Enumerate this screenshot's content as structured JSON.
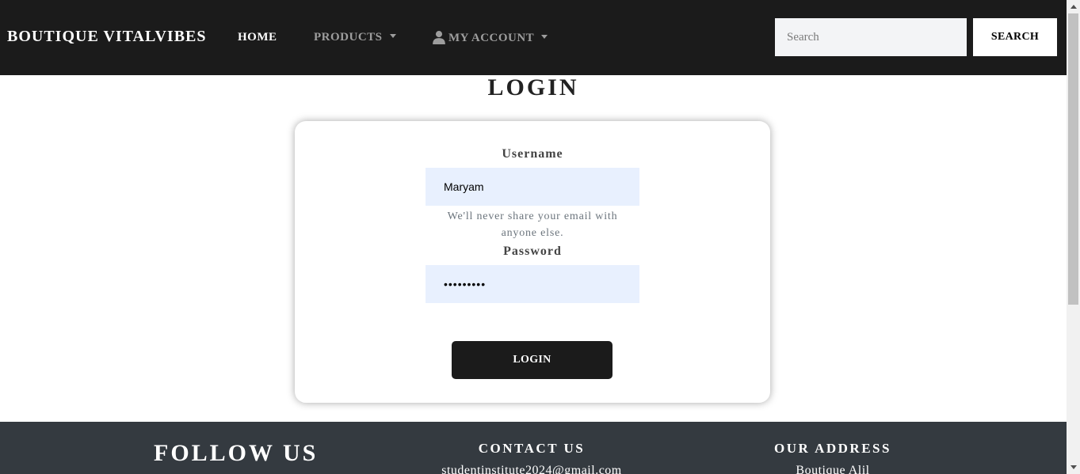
{
  "navbar": {
    "brand": "BOUTIQUE VITALVIBES",
    "home": "HOME",
    "products": "PRODUCTS",
    "account": "MY ACCOUNT",
    "search_placeholder": "Search",
    "search_button": "SEARCH",
    "account_icon": "user-icon"
  },
  "login": {
    "title": "LOGIN",
    "username_label": "Username",
    "username_value": "Maryam",
    "help_text": "We'll never share your email with anyone else.",
    "password_label": "Password",
    "password_value": "password1",
    "button": "LOGIN"
  },
  "footer": {
    "follow": "FOLLOW US",
    "contact_heading": "CONTACT US",
    "contact_email": "studentinstitute2024@gmail.com",
    "address_heading": "OUR ADDRESS",
    "address_line": "Boutique Alil"
  },
  "colors": {
    "navbar_bg": "#1b1b1b",
    "footer_bg": "#343a40",
    "input_autofill_bg": "#e8f0fe",
    "button_bg": "#1b1b1b"
  }
}
